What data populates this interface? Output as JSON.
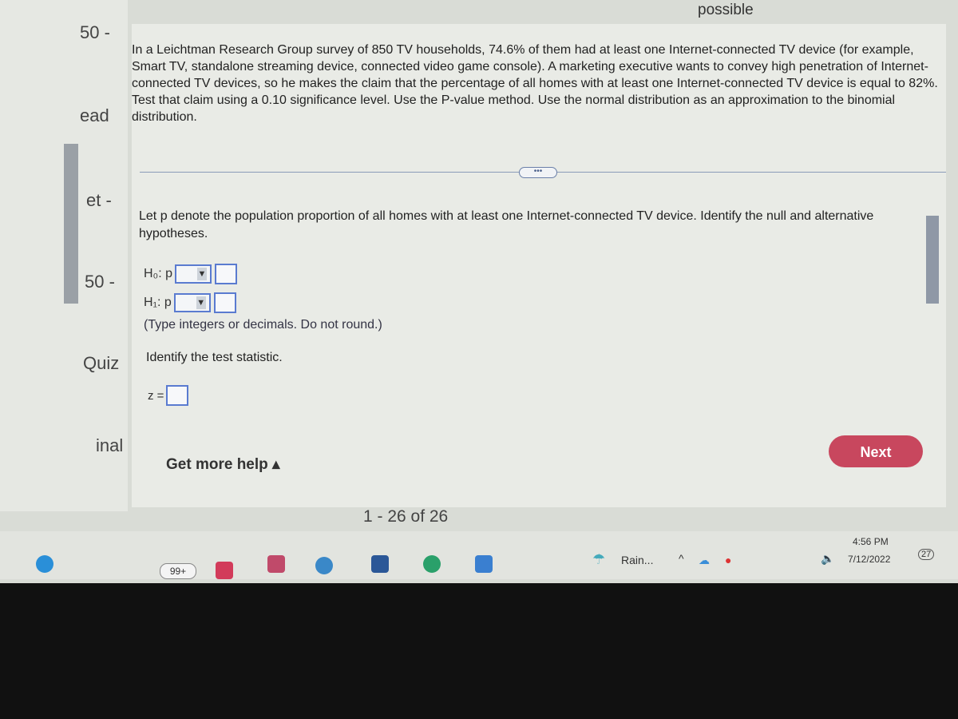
{
  "header": {
    "points_label": "possible"
  },
  "left_column": {
    "labels": [
      "50 -",
      "ead",
      "et -",
      "50 -",
      "Quiz",
      "inal"
    ]
  },
  "problem": {
    "text": "In a Leichtman Research Group survey of 850 TV households, 74.6% of them had at least one Internet-connected TV device (for example, Smart TV, standalone streaming device, connected video game console). A marketing executive wants to convey high penetration of Internet-connected TV devices, so he makes the claim that the percentage of all homes with at least one Internet-connected TV device is equal to 82%. Test that claim using a 0.10 significance level. Use the P-value method. Use the normal distribution as an approximation to the binomial distribution."
  },
  "expand_label": "•••",
  "question": {
    "prompt": "Let p denote the population proportion of all homes with at least one Internet-connected TV device. Identify the null and alternative hypotheses.",
    "h0_label": "H₀: p",
    "h1_label": "H₁: p",
    "h0_operator": "",
    "h1_operator": "",
    "h0_value": "",
    "h1_value": "",
    "note": "(Type integers or decimals. Do not round.)",
    "test_stat_prompt": "Identify the test statistic.",
    "z_label": "z =",
    "z_value": ""
  },
  "help_label": "Get more help ▴",
  "next_label": "Next",
  "pager": "1 - 26 of 26",
  "taskbar": {
    "badge": "99+",
    "weather": "Rain...",
    "time": "4:56 PM",
    "date": "7/12/2022",
    "notifications": "27"
  },
  "colors": {
    "accent": "#c8475e",
    "input_border": "#5a7bd0"
  }
}
